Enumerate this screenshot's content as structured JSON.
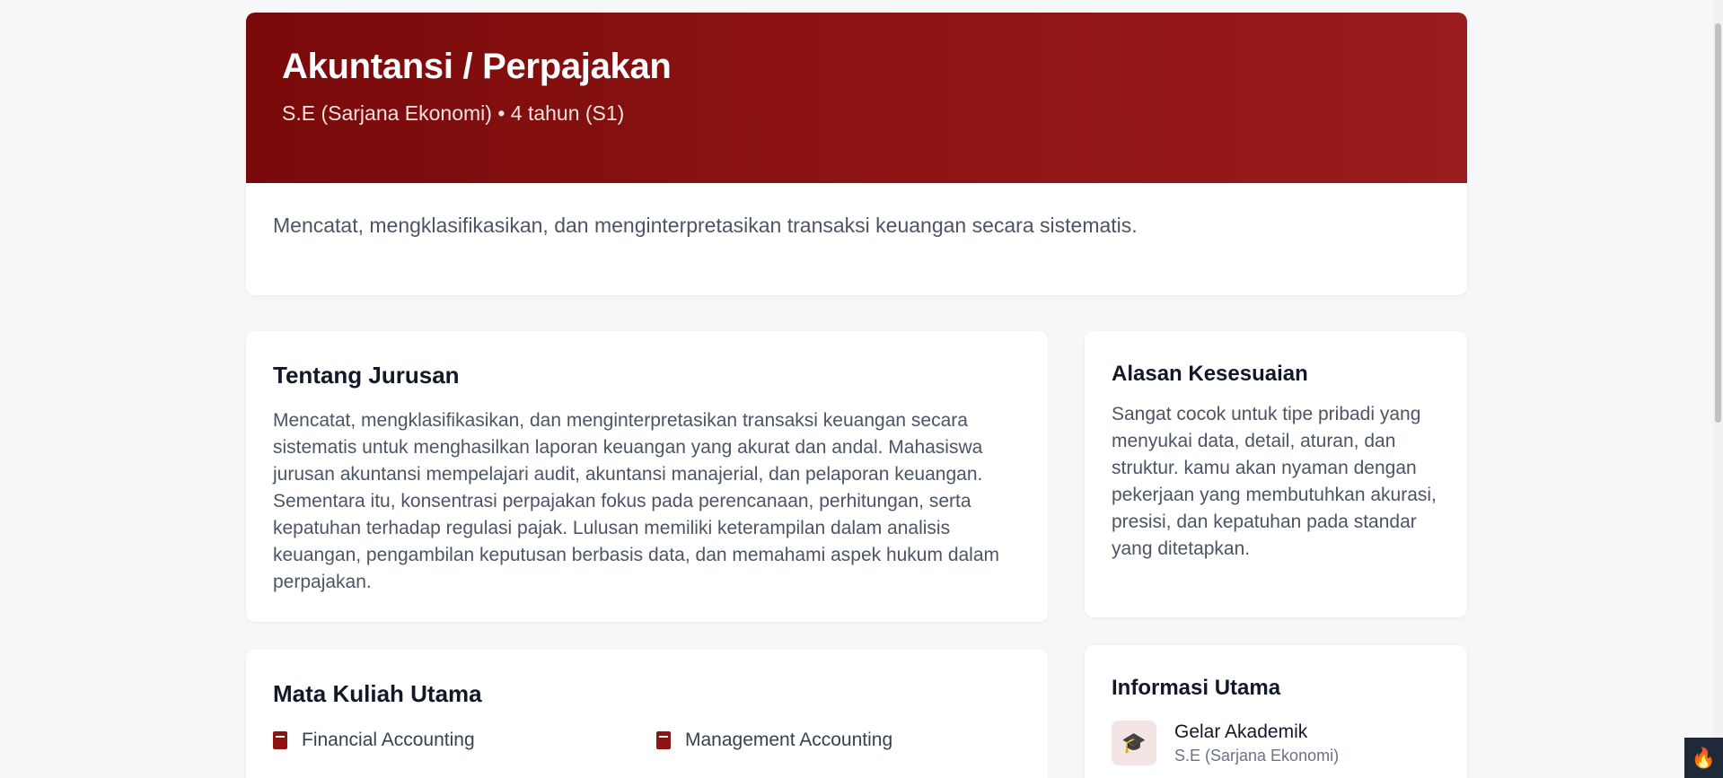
{
  "hero": {
    "title": "Akuntansi / Perpajakan",
    "subtitle": "S.E (Sarjana Ekonomi) • 4 tahun (S1)",
    "description": "Mencatat, mengklasifikasikan, dan menginterpretasikan transaksi keuangan secara sistematis."
  },
  "about": {
    "title": "Tentang Jurusan",
    "body": "Mencatat, mengklasifikasikan, dan menginterpretasikan transaksi keuangan secara sistematis untuk menghasilkan laporan keuangan yang akurat dan andal. Mahasiswa jurusan akuntansi mempelajari audit, akuntansi manajerial, dan pelaporan keuangan. Sementara itu, konsentrasi perpajakan fokus pada perencanaan, perhitungan, serta kepatuhan terhadap regulasi pajak. Lulusan memiliki keterampilan dalam analisis keuangan, pengambilan keputusan berbasis data, dan memahami aspek hukum dalam perpajakan."
  },
  "reason": {
    "title": "Alasan Kesesuaian",
    "body": "Sangat cocok untuk tipe pribadi yang menyukai data, detail, aturan, dan struktur. kamu akan nyaman dengan pekerjaan yang membutuhkan akurasi, presisi, dan kepatuhan pada standar yang ditetapkan."
  },
  "courses": {
    "title": "Mata Kuliah Utama",
    "items": [
      {
        "label": "Financial Accounting",
        "icon": "book-icon"
      },
      {
        "label": "Management Accounting",
        "icon": "book-icon"
      }
    ]
  },
  "info": {
    "title": "Informasi Utama",
    "items": [
      {
        "icon": "graduation-cap-icon",
        "label": "Gelar Akademik",
        "value": "S.E (Sarjana Ekonomi)"
      }
    ]
  },
  "colors": {
    "accent": "#8e1414",
    "banner_start": "#7a0a0a",
    "banner_end": "#9a1c1c",
    "page_background": "#f6f7f9"
  },
  "corner_widget": {
    "icon": "flame-icon"
  }
}
